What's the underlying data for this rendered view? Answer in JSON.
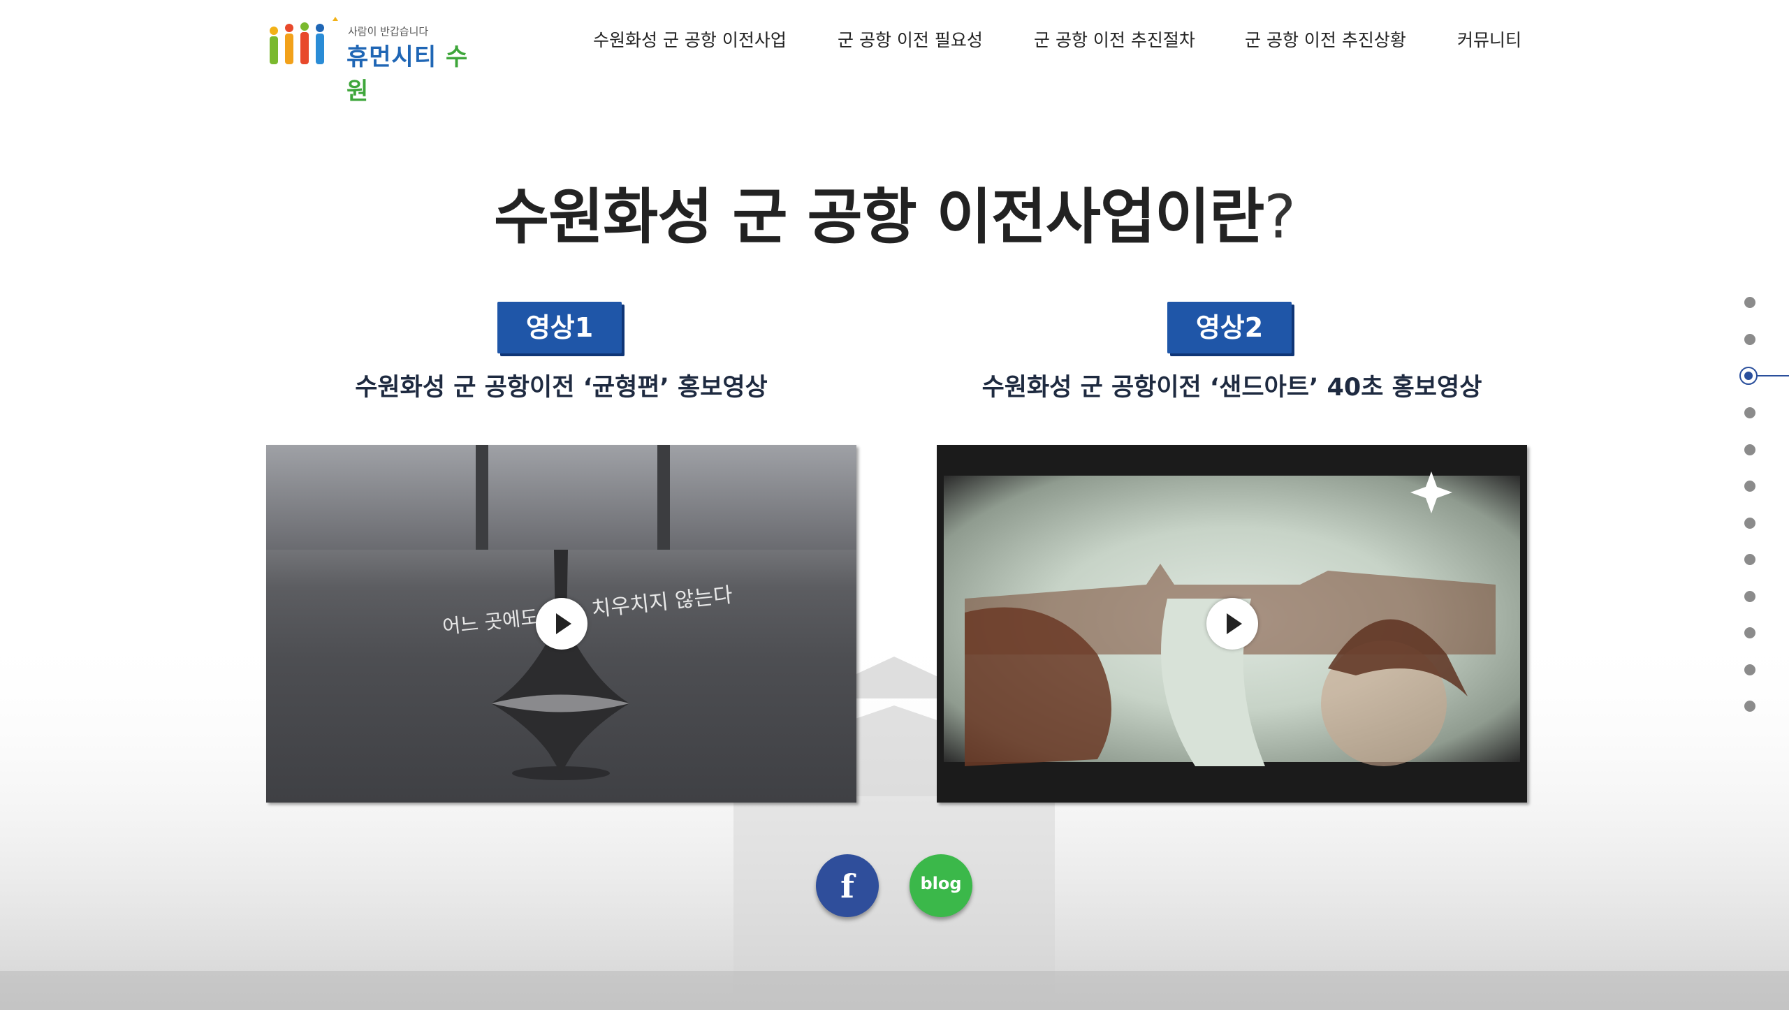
{
  "logo": {
    "tagline": "사람이 반갑습니다",
    "name_part1": "휴먼시티",
    "name_part2": "수원"
  },
  "nav": {
    "items": [
      {
        "label": "수원화성 군 공항 이전사업"
      },
      {
        "label": "군 공항 이전 필요성"
      },
      {
        "label": "군 공항 이전 추진절차"
      },
      {
        "label": "군 공항 이전 추진상황"
      },
      {
        "label": "커뮤니티"
      }
    ]
  },
  "main": {
    "title": "수원화성 군 공항 이전사업이란",
    "title_mark": "?",
    "videos": [
      {
        "badge": "영상1",
        "subtitle": "수원화성 군 공항이전 ‘균형편’ 홍보영상",
        "caption_left": "어느 곳에도",
        "caption_right": "치우치지 않는다"
      },
      {
        "badge": "영상2",
        "subtitle": "수원화성 군 공항이전 ‘샌드아트’ 40초 홍보영상"
      }
    ]
  },
  "social": {
    "facebook_icon": "f",
    "blog_label": "blog"
  },
  "side_nav": {
    "count": 12,
    "active_index": 2,
    "active_color": "#2a4f9c"
  },
  "colors": {
    "badge": "#1f56a8",
    "facebook": "#2f4e9b",
    "blog": "#3bb84a"
  }
}
